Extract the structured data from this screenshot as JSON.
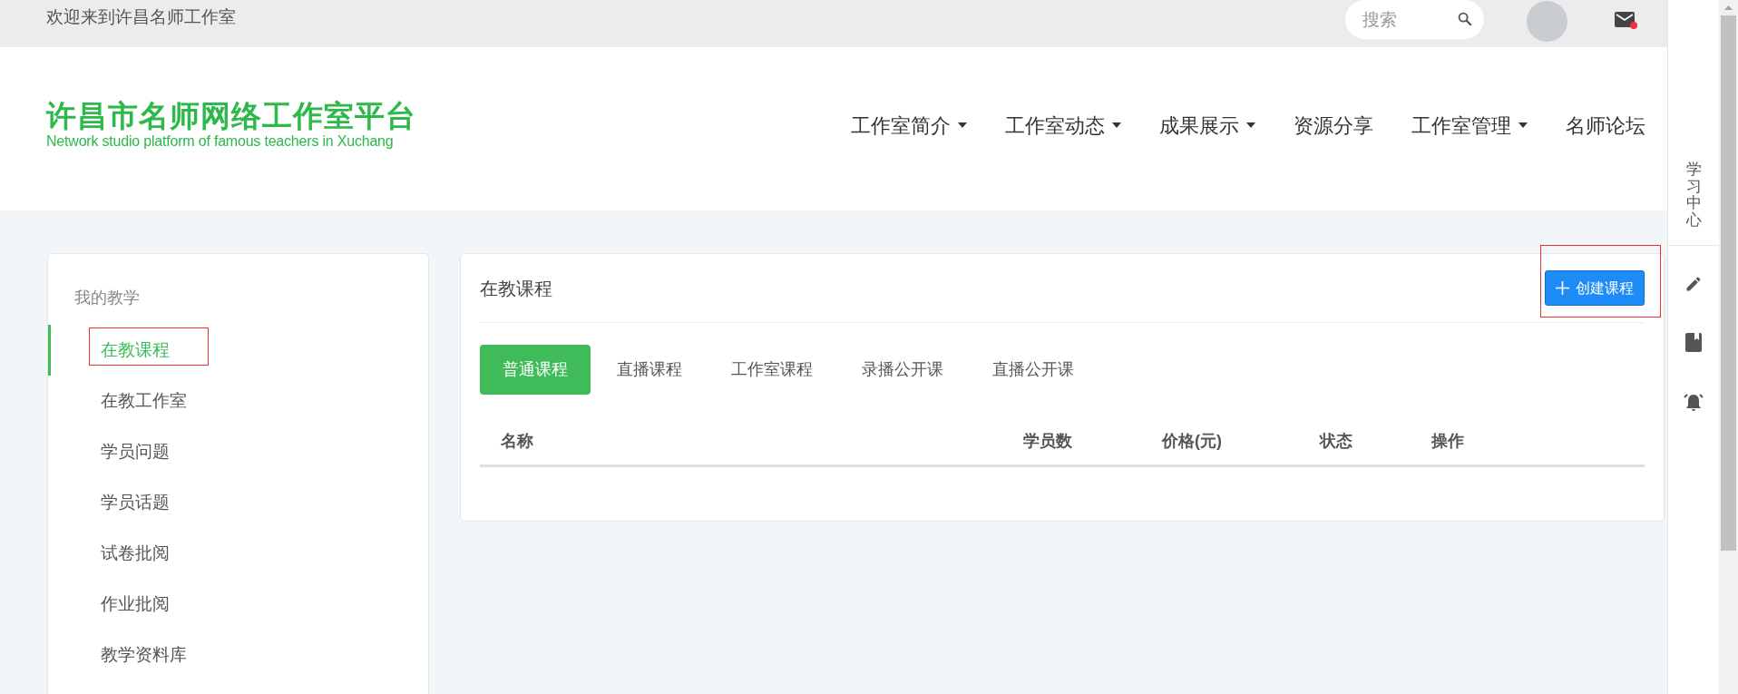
{
  "top_bar": {
    "welcome": "欢迎来到许昌名师工作室",
    "search": {
      "placeholder": "搜索"
    },
    "mail": {
      "unread": true
    }
  },
  "logo": {
    "title": "许昌市名师网络工作室平台",
    "subtitle": "Network studio platform of famous teachers in Xuchang"
  },
  "nav": [
    {
      "label": "工作室简介",
      "dropdown": true
    },
    {
      "label": "工作室动态",
      "dropdown": true
    },
    {
      "label": "成果展示",
      "dropdown": true
    },
    {
      "label": "资源分享",
      "dropdown": false
    },
    {
      "label": "工作室管理",
      "dropdown": true
    },
    {
      "label": "名师论坛",
      "dropdown": false
    }
  ],
  "sidebar": {
    "heading": "我的教学",
    "items": [
      {
        "label": "在教课程",
        "selected": true
      },
      {
        "label": "在教工作室",
        "selected": false
      },
      {
        "label": "学员问题",
        "selected": false
      },
      {
        "label": "学员话题",
        "selected": false
      },
      {
        "label": "试卷批阅",
        "selected": false
      },
      {
        "label": "作业批阅",
        "selected": false
      },
      {
        "label": "教学资料库",
        "selected": false
      }
    ]
  },
  "panel": {
    "title": "在教课程",
    "create_button": "创建课程",
    "tabs": [
      {
        "label": "普通课程",
        "selected": true
      },
      {
        "label": "直播课程",
        "selected": false
      },
      {
        "label": "工作室课程",
        "selected": false
      },
      {
        "label": "录播公开课",
        "selected": false
      },
      {
        "label": "直播公开课",
        "selected": false
      }
    ],
    "table": {
      "columns": [
        "名称",
        "学员数",
        "价格(元)",
        "状态",
        "操作"
      ]
    }
  },
  "right_rail": {
    "label": "学习中心"
  }
}
